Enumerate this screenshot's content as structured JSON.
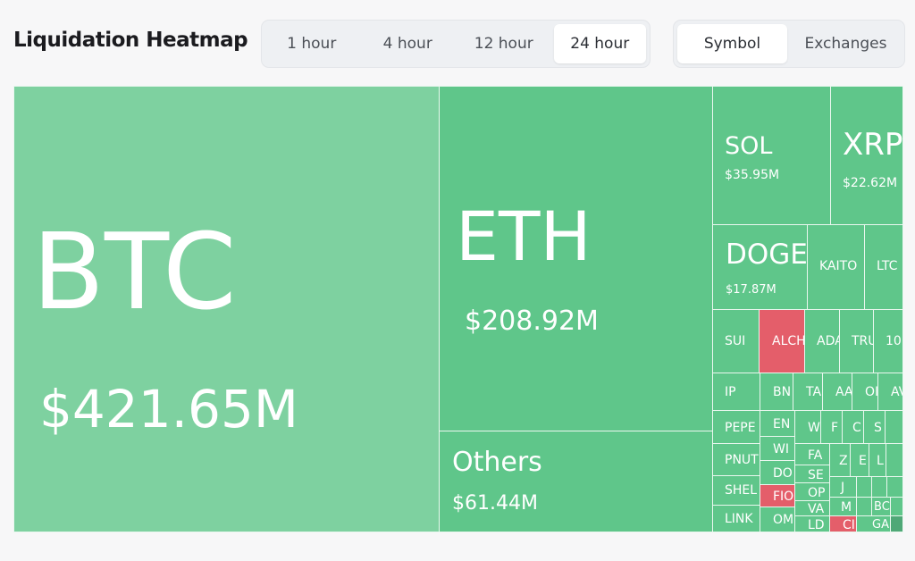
{
  "header": {
    "title": "Liquidation Heatmap"
  },
  "timeframes": {
    "options": [
      "1 hour",
      "4 hour",
      "12 hour",
      "24 hour"
    ],
    "selected": "24 hour"
  },
  "views": {
    "options": [
      "Symbol",
      "Exchanges"
    ],
    "selected": "Symbol"
  },
  "colors": {
    "long_liq": "#5fc68a",
    "long_liq_largest": "#7ed1a0",
    "short_liq": "#e45e6a",
    "border": "#eaf7ef"
  },
  "heatmap": {
    "BTC": {
      "symbol": "BTC",
      "value": "$421.65M"
    },
    "ETH": {
      "symbol": "ETH",
      "value": "$208.92M"
    },
    "Others": {
      "symbol": "Others",
      "value": "$61.44M"
    },
    "SOL": {
      "symbol": "SOL",
      "value": "$35.95M"
    },
    "XRP": {
      "symbol": "XRP",
      "value": "$22.62M"
    },
    "DOGE": {
      "symbol": "DOGE",
      "value": "$17.87M"
    },
    "KAITO": {
      "symbol": "KAITO"
    },
    "LTC": {
      "symbol": "LTC"
    },
    "SUI": {
      "symbol": "SUI"
    },
    "ALCH": {
      "symbol": "ALCH"
    },
    "ADA": {
      "symbol": "ADA"
    },
    "TRU": {
      "symbol": "TRU"
    },
    "T10": {
      "symbol": "10"
    },
    "IP": {
      "symbol": "IP"
    },
    "BN": {
      "symbol": "BN"
    },
    "TA": {
      "symbol": "TA"
    },
    "AA": {
      "symbol": "AA"
    },
    "OI": {
      "symbol": "OI"
    },
    "AV": {
      "symbol": "AV"
    },
    "PEPE": {
      "symbol": "PEPE"
    },
    "EN": {
      "symbol": "EN"
    },
    "W": {
      "symbol": "W"
    },
    "F": {
      "symbol": "F"
    },
    "C": {
      "symbol": "C"
    },
    "S": {
      "symbol": "S"
    },
    "PNUT": {
      "symbol": "PNUT"
    },
    "WI": {
      "symbol": "WI"
    },
    "FA": {
      "symbol": "FA"
    },
    "Z": {
      "symbol": "Z"
    },
    "E": {
      "symbol": "E"
    },
    "L": {
      "symbol": "L"
    },
    "DO": {
      "symbol": "DO"
    },
    "SE": {
      "symbol": "SE"
    },
    "J": {
      "symbol": "J"
    },
    "SHEL": {
      "symbol": "SHEL"
    },
    "FIO": {
      "symbol": "FIO"
    },
    "OP": {
      "symbol": "OP"
    },
    "M": {
      "symbol": "M"
    },
    "VA": {
      "symbol": "VA"
    },
    "BC": {
      "symbol": "BC"
    },
    "LINK": {
      "symbol": "LINK"
    },
    "OM": {
      "symbol": "OM"
    },
    "LD": {
      "symbol": "LD"
    },
    "CI": {
      "symbol": "CI"
    },
    "GA": {
      "symbol": "GA"
    }
  }
}
